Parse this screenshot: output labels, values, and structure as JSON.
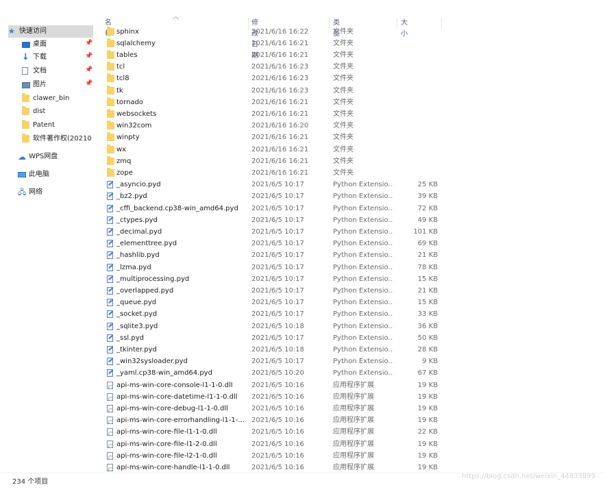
{
  "nav": {
    "quick_access": "快速访问",
    "desktop": "桌面",
    "downloads": "下载",
    "documents": "文档",
    "pictures": "图片",
    "folders": [
      "clawer_bin",
      "dist",
      "Patent",
      "软件著作权(20210"
    ],
    "wps": "WPS网盘",
    "this_pc": "此电脑",
    "network": "网络"
  },
  "columns": {
    "name": "名称",
    "date": "修改日期",
    "type": "类型",
    "size": "大小"
  },
  "rows": [
    {
      "name": "sphinx",
      "date": "2021/6/16 16:22",
      "type": "文件夹",
      "size": "",
      "kind": "folder"
    },
    {
      "name": "sqlalchemy",
      "date": "2021/6/16 16:21",
      "type": "文件夹",
      "size": "",
      "kind": "folder"
    },
    {
      "name": "tables",
      "date": "2021/6/16 16:21",
      "type": "文件夹",
      "size": "",
      "kind": "folder"
    },
    {
      "name": "tcl",
      "date": "2021/6/16 16:23",
      "type": "文件夹",
      "size": "",
      "kind": "folder"
    },
    {
      "name": "tcl8",
      "date": "2021/6/16 16:23",
      "type": "文件夹",
      "size": "",
      "kind": "folder"
    },
    {
      "name": "tk",
      "date": "2021/6/16 16:23",
      "type": "文件夹",
      "size": "",
      "kind": "folder"
    },
    {
      "name": "tornado",
      "date": "2021/6/16 16:21",
      "type": "文件夹",
      "size": "",
      "kind": "folder"
    },
    {
      "name": "websockets",
      "date": "2021/6/16 16:21",
      "type": "文件夹",
      "size": "",
      "kind": "folder"
    },
    {
      "name": "win32com",
      "date": "2021/6/16 16:20",
      "type": "文件夹",
      "size": "",
      "kind": "folder"
    },
    {
      "name": "winpty",
      "date": "2021/6/16 16:21",
      "type": "文件夹",
      "size": "",
      "kind": "folder"
    },
    {
      "name": "wx",
      "date": "2021/6/16 16:21",
      "type": "文件夹",
      "size": "",
      "kind": "folder"
    },
    {
      "name": "zmq",
      "date": "2021/6/16 16:21",
      "type": "文件夹",
      "size": "",
      "kind": "folder"
    },
    {
      "name": "zope",
      "date": "2021/6/16 16:21",
      "type": "文件夹",
      "size": "",
      "kind": "folder"
    },
    {
      "name": "_asyncio.pyd",
      "date": "2021/6/5 10:17",
      "type": "Python Extensio...",
      "size": "25 KB",
      "kind": "pyd"
    },
    {
      "name": "_bz2.pyd",
      "date": "2021/6/5 10:17",
      "type": "Python Extensio...",
      "size": "39 KB",
      "kind": "pyd"
    },
    {
      "name": "_cffi_backend.cp38-win_amd64.pyd",
      "date": "2021/6/5 10:17",
      "type": "Python Extensio...",
      "size": "72 KB",
      "kind": "pyd"
    },
    {
      "name": "_ctypes.pyd",
      "date": "2021/6/5 10:17",
      "type": "Python Extensio...",
      "size": "49 KB",
      "kind": "pyd"
    },
    {
      "name": "_decimal.pyd",
      "date": "2021/6/5 10:17",
      "type": "Python Extensio...",
      "size": "101 KB",
      "kind": "pyd"
    },
    {
      "name": "_elementtree.pyd",
      "date": "2021/6/5 10:17",
      "type": "Python Extensio...",
      "size": "69 KB",
      "kind": "pyd"
    },
    {
      "name": "_hashlib.pyd",
      "date": "2021/6/5 10:17",
      "type": "Python Extensio...",
      "size": "21 KB",
      "kind": "pyd"
    },
    {
      "name": "_lzma.pyd",
      "date": "2021/6/5 10:17",
      "type": "Python Extensio...",
      "size": "78 KB",
      "kind": "pyd"
    },
    {
      "name": "_multiprocessing.pyd",
      "date": "2021/6/5 10:17",
      "type": "Python Extensio...",
      "size": "15 KB",
      "kind": "pyd"
    },
    {
      "name": "_overlapped.pyd",
      "date": "2021/6/5 10:17",
      "type": "Python Extensio...",
      "size": "21 KB",
      "kind": "pyd"
    },
    {
      "name": "_queue.pyd",
      "date": "2021/6/5 10:17",
      "type": "Python Extensio...",
      "size": "15 KB",
      "kind": "pyd"
    },
    {
      "name": "_socket.pyd",
      "date": "2021/6/5 10:17",
      "type": "Python Extensio...",
      "size": "33 KB",
      "kind": "pyd"
    },
    {
      "name": "_sqlite3.pyd",
      "date": "2021/6/5 10:18",
      "type": "Python Extensio...",
      "size": "36 KB",
      "kind": "pyd"
    },
    {
      "name": "_ssl.pyd",
      "date": "2021/6/5 10:17",
      "type": "Python Extensio...",
      "size": "50 KB",
      "kind": "pyd"
    },
    {
      "name": "_tkinter.pyd",
      "date": "2021/6/5 10:18",
      "type": "Python Extensio...",
      "size": "28 KB",
      "kind": "pyd"
    },
    {
      "name": "_win32sysloader.pyd",
      "date": "2021/6/5 10:17",
      "type": "Python Extensio...",
      "size": "9 KB",
      "kind": "pyd"
    },
    {
      "name": "_yaml.cp38-win_amd64.pyd",
      "date": "2021/6/5 10:20",
      "type": "Python Extensio...",
      "size": "67 KB",
      "kind": "pyd"
    },
    {
      "name": "api-ms-win-core-console-l1-1-0.dll",
      "date": "2021/6/5 10:16",
      "type": "应用程序扩展",
      "size": "19 KB",
      "kind": "dll"
    },
    {
      "name": "api-ms-win-core-datetime-l1-1-0.dll",
      "date": "2021/6/5 10:16",
      "type": "应用程序扩展",
      "size": "19 KB",
      "kind": "dll"
    },
    {
      "name": "api-ms-win-core-debug-l1-1-0.dll",
      "date": "2021/6/5 10:16",
      "type": "应用程序扩展",
      "size": "19 KB",
      "kind": "dll"
    },
    {
      "name": "api-ms-win-core-errorhandling-l1-1-...",
      "date": "2021/6/5 10:16",
      "type": "应用程序扩展",
      "size": "19 KB",
      "kind": "dll"
    },
    {
      "name": "api-ms-win-core-file-l1-1-0.dll",
      "date": "2021/6/5 10:16",
      "type": "应用程序扩展",
      "size": "22 KB",
      "kind": "dll"
    },
    {
      "name": "api-ms-win-core-file-l1-2-0.dll",
      "date": "2021/6/5 10:16",
      "type": "应用程序扩展",
      "size": "19 KB",
      "kind": "dll"
    },
    {
      "name": "api-ms-win-core-file-l2-1-0.dll",
      "date": "2021/6/5 10:16",
      "type": "应用程序扩展",
      "size": "19 KB",
      "kind": "dll"
    },
    {
      "name": "api-ms-win-core-handle-l1-1-0.dll",
      "date": "2021/6/5 10:16",
      "type": "应用程序扩展",
      "size": "19 KB",
      "kind": "dll"
    }
  ],
  "status": {
    "count": "234 个项目"
  },
  "watermark": "https://blog.csdn.net/weixin_44833899"
}
